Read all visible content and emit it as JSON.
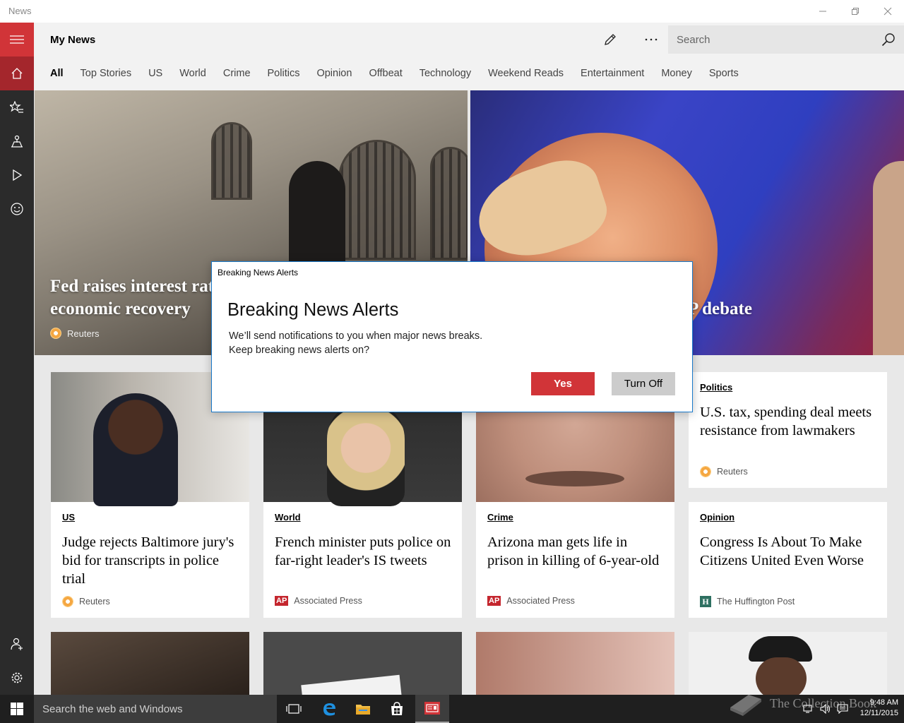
{
  "window": {
    "app_name": "News"
  },
  "header": {
    "title": "My News",
    "search_placeholder": "Search",
    "tabs": [
      "All",
      "Top Stories",
      "US",
      "World",
      "Crime",
      "Politics",
      "Opinion",
      "Offbeat",
      "Technology",
      "Weekend Reads",
      "Entertainment",
      "Money",
      "Sports"
    ],
    "active_tab": "All"
  },
  "rail": {
    "items": [
      "hamburger-icon",
      "home-icon",
      "favorites-icon",
      "local-icon",
      "video-icon",
      "sports-icon",
      "account-icon",
      "settings-icon"
    ]
  },
  "hero": {
    "left": {
      "headline": "Fed raises interest rat… economic recovery",
      "headline_line1": "Fed raises interest rat",
      "headline_line2": "economic recovery",
      "source": "Reuters"
    },
    "right": {
      "headline": "P debate"
    }
  },
  "cards": [
    {
      "category": "Politics",
      "headline": "U.S. tax, spending deal meets resistance from lawmakers",
      "source": "Reuters",
      "logo": "reuters"
    },
    {
      "category": "US",
      "headline": "Judge rejects Baltimore jury's bid for transcripts in police trial",
      "source": "Reuters",
      "logo": "reuters"
    },
    {
      "category": "World",
      "headline": "French minister puts police on far-right leader's IS tweets",
      "source": "Associated Press",
      "logo": "ap"
    },
    {
      "category": "Crime",
      "headline": "Arizona man gets life in prison in killing of 6-year-old",
      "source": "Associated Press",
      "logo": "ap"
    },
    {
      "category": "Opinion",
      "headline": "Congress Is About To Make Citizens United Even Worse",
      "source": "The Huffington Post",
      "logo": "huffpost"
    }
  ],
  "dialog": {
    "window_title": "Breaking News Alerts",
    "heading": "Breaking News Alerts",
    "body_line1": "We’ll send notifications to you when major news breaks.",
    "body_line2": "Keep breaking news alerts on?",
    "yes_label": "Yes",
    "off_label": "Turn Off"
  },
  "taskbar": {
    "search_placeholder": "Search the web and Windows",
    "time": "9:48 AM",
    "date": "12/11/2015"
  },
  "watermark": {
    "text": "The Collection Book"
  },
  "colors": {
    "accent": "#d13438",
    "rail": "#2b2b2b",
    "taskbar": "#1f1f1f"
  }
}
